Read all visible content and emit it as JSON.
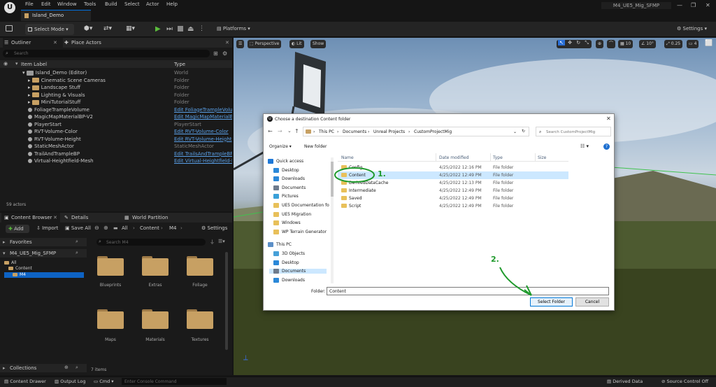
{
  "menubar": {
    "items": [
      "File",
      "Edit",
      "Window",
      "Tools",
      "Build",
      "Select",
      "Actor",
      "Help"
    ],
    "project_tab": "Island_Demo",
    "project_name": "M4_UE5_Mig_SFMP"
  },
  "toolbar": {
    "select_mode": "Select Mode",
    "platforms": "Platforms",
    "settings": "Settings"
  },
  "outliner": {
    "tab": "Outliner",
    "tab2": "Place Actors",
    "search_placeholder": "Search",
    "col_label": "Item Label",
    "col_type": "Type",
    "rows": [
      {
        "label": "Island_Demo (Editor)",
        "type": "World",
        "kind": "world",
        "indent": 0,
        "link": false
      },
      {
        "label": "Cinematic Scene Cameras",
        "type": "Folder",
        "kind": "folder",
        "indent": 1,
        "link": false
      },
      {
        "label": "Landscape Stuff",
        "type": "Folder",
        "kind": "folder",
        "indent": 1,
        "link": false
      },
      {
        "label": "Lighting & Visuals",
        "type": "Folder",
        "kind": "folder",
        "indent": 1,
        "link": false
      },
      {
        "label": "MiniTutorialStuff",
        "type": "Folder",
        "kind": "folder",
        "indent": 1,
        "link": false
      },
      {
        "label": "FoliageTrampleVolume",
        "type": "Edit FoliageTrampleVolume",
        "kind": "actor",
        "indent": 1,
        "link": true
      },
      {
        "label": "MagicMapMaterialBP-V2",
        "type": "Edit MagicMapMaterialBP-",
        "kind": "actor",
        "indent": 1,
        "link": true
      },
      {
        "label": "PlayerStart",
        "type": "PlayerStart",
        "kind": "actor",
        "indent": 1,
        "link": false
      },
      {
        "label": "RVT-Volume-Color",
        "type": "Edit RVT-Volume-Color",
        "kind": "actor",
        "indent": 1,
        "link": true
      },
      {
        "label": "RVT-Volume-Height",
        "type": "Edit RVT-Volume-Height",
        "kind": "actor",
        "indent": 1,
        "link": true
      },
      {
        "label": "StaticMeshActor",
        "type": "StaticMeshActor",
        "kind": "actor",
        "indent": 1,
        "link": false
      },
      {
        "label": "TrailAndTrampleBP",
        "type": "Edit TrailsAndTrampleBP",
        "kind": "actor",
        "indent": 1,
        "link": true
      },
      {
        "label": "Virtual-Heightfield-Mesh",
        "type": "Edit Virtual-Heightfield-Me",
        "kind": "actor",
        "indent": 1,
        "link": true
      }
    ],
    "actor_count": "59 actors"
  },
  "content_browser": {
    "tab": "Content Browser",
    "tab_details": "Details",
    "tab_world": "World Partition",
    "add": "Add",
    "import": "Import",
    "save_all": "Save All",
    "path": [
      "All",
      "Content",
      "M4"
    ],
    "settings": "Settings",
    "favorites": "Favorites",
    "project": "M4_UE5_Mig_SFMP",
    "tree": [
      "All",
      "Content",
      "M4"
    ],
    "search_placeholder": "Search M4",
    "folders": [
      "Blueprints",
      "Extras",
      "Foliage",
      "Maps",
      "Materials",
      "Textures"
    ],
    "item_count": "7 items",
    "collections": "Collections"
  },
  "viewport": {
    "perspective": "Perspective",
    "lit": "Lit",
    "show": "Show",
    "grid_value": "10",
    "angle_value": "10°",
    "scale_value": "0.25",
    "cam_speed": "4"
  },
  "dialog": {
    "title": "Choose a destination Content folder",
    "breadcrumb": [
      "This PC",
      "Documents",
      "Unreal Projects",
      "CustomProjectMig"
    ],
    "search_placeholder": "Search CustomProjectMig",
    "organize": "Organize",
    "new_folder": "New folder",
    "nav": [
      {
        "label": "Quick access",
        "icon": "star"
      },
      {
        "label": "Desktop",
        "icon": "desktop"
      },
      {
        "label": "Downloads",
        "icon": "download"
      },
      {
        "label": "Documents",
        "icon": "doc"
      },
      {
        "label": "Pictures",
        "icon": "pic"
      },
      {
        "label": "UE5 Documentation fo",
        "icon": "folder"
      },
      {
        "label": "UE5 Migration",
        "icon": "folder"
      },
      {
        "label": "Windows",
        "icon": "folder"
      },
      {
        "label": "WP Terrain Generator",
        "icon": "folder"
      },
      {
        "label": "This PC",
        "icon": "pc"
      },
      {
        "label": "3D Objects",
        "icon": "cube"
      },
      {
        "label": "Desktop",
        "icon": "desktop"
      },
      {
        "label": "Documents",
        "icon": "doc"
      },
      {
        "label": "Downloads",
        "icon": "download"
      }
    ],
    "columns": {
      "name": "Name",
      "date": "Date modified",
      "type": "Type",
      "size": "Size"
    },
    "files": [
      {
        "name": "Config",
        "date": "4/25/2022 12:16 PM",
        "type": "File folder"
      },
      {
        "name": "Content",
        "date": "4/25/2022 12:49 PM",
        "type": "File folder"
      },
      {
        "name": "DerivedDataCache",
        "date": "4/25/2022 12:13 PM",
        "type": "File folder"
      },
      {
        "name": "Intermediate",
        "date": "4/25/2022 12:49 PM",
        "type": "File folder"
      },
      {
        "name": "Saved",
        "date": "4/25/2022 12:49 PM",
        "type": "File folder"
      },
      {
        "name": "Script",
        "date": "4/25/2022 12:49 PM",
        "type": "File folder"
      }
    ],
    "folder_label": "Folder:",
    "folder_value": "Content",
    "select_button": "Select Folder",
    "cancel_button": "Cancel"
  },
  "annotations": {
    "step1": "1.",
    "step2": "2."
  },
  "statusbar": {
    "content_drawer": "Content Drawer",
    "output_log": "Output Log",
    "cmd": "Cmd",
    "console_placeholder": "Enter Console Command",
    "derived_data": "Derived Data",
    "source_control": "Source Control Off"
  },
  "colors": {
    "accent": "#0070e0",
    "link": "#5aa0e8",
    "folder": "#c7a063",
    "annotation": "#1f9a2c",
    "selected_row": "#cce8ff"
  }
}
